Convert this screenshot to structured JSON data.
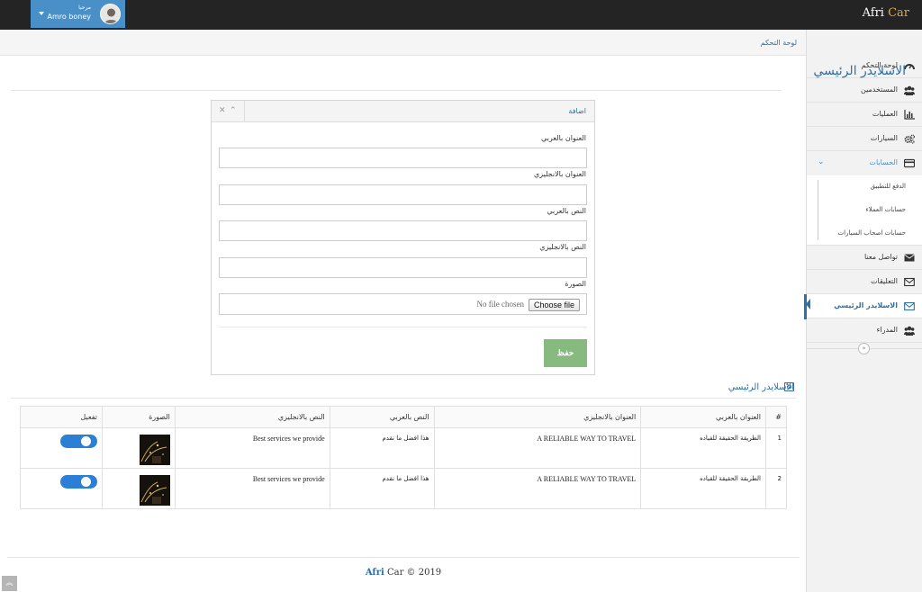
{
  "topbar": {
    "brand_part1": "Afri",
    "brand_part2": "Car",
    "user_greeting": "مرحبا",
    "user_name": "Amro boney"
  },
  "sidebar": {
    "items": [
      {
        "label": "لوحة التحكم",
        "icon": "dashboard-icon"
      },
      {
        "label": "المستخدمين",
        "icon": "users-icon"
      },
      {
        "label": "العمليات",
        "icon": "bar-chart-icon"
      },
      {
        "label": "السيارات",
        "icon": "gears-icon"
      },
      {
        "label": "الحسابات",
        "icon": "credit-card-icon",
        "open": true
      },
      {
        "label": "تواصل معنا",
        "icon": "envelope-icon"
      },
      {
        "label": "التعليقات",
        "icon": "envelope-outline-icon"
      },
      {
        "label": "الاسلايدر الرئيسي",
        "icon": "envelope-outline-icon",
        "active": true
      },
      {
        "label": "المدراء",
        "icon": "users-icon"
      }
    ],
    "subitems": [
      {
        "label": "الدفع للتطبيق"
      },
      {
        "label": "حسابات العملاء"
      },
      {
        "label": "حسابات اصحاب السيارات"
      }
    ],
    "collapse_glyph": "«"
  },
  "breadcrumb": "لوحة التحكم",
  "page_title": "الاسلايدر الرئيسي",
  "form": {
    "panel_title": "اضافة",
    "fields": [
      {
        "label": "العنوان بالعربي",
        "value": ""
      },
      {
        "label": "العنوان بالانجليزي",
        "value": ""
      },
      {
        "label": "النص بالعربي",
        "value": ""
      },
      {
        "label": "النص بالانجليزي",
        "value": ""
      }
    ],
    "image_label": "الصورة",
    "file_button": "Choose file",
    "file_status": "No file chosen",
    "save_label": "حفظ"
  },
  "table_section": {
    "title": "الاسلايدر الرئيسي",
    "headers": [
      "#",
      "العنوان بالعربي",
      "العنوان بالانجليزي",
      "النص بالعربي",
      "النص بالانجليزي",
      "الصورة",
      "تفعيل"
    ],
    "rows": [
      {
        "num": "1",
        "title_ar": "الطريقة الحقيقة للقياده",
        "title_en": "A RELIABLE WAY TO TRAVEL",
        "text_ar": "هذا افضل ما نقدم",
        "text_en": "Best services we provide",
        "active": true
      },
      {
        "num": "2",
        "title_ar": "الطريقة الحقيقة للقياده",
        "title_en": "A RELIABLE WAY TO TRAVEL",
        "text_ar": "هذا افضل ما نقدم",
        "text_en": "Best services we provide",
        "active": true
      }
    ]
  },
  "footer": {
    "brand_part1": "Afri",
    "rest": "Car © 2019"
  },
  "colors": {
    "accent": "#2f6fa7",
    "save_button": "#87ba7f",
    "toggle_on": "#2b7fd4",
    "brand_highlight": "#f0a52b",
    "topbar": "#242424"
  }
}
